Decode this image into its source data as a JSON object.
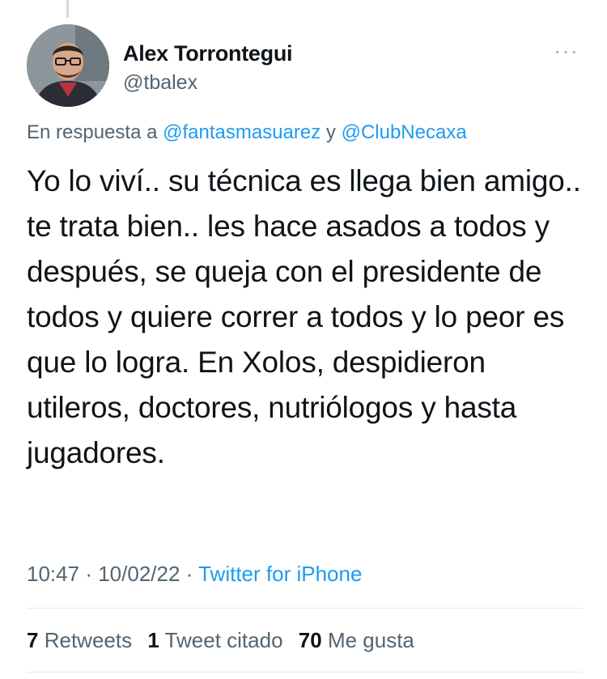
{
  "author": {
    "name": "Alex Torrontegui",
    "handle": "@tbalex"
  },
  "more_menu": {
    "icon": "more-horizontal-icon",
    "label": "···"
  },
  "reply": {
    "prefix": "En respuesta a",
    "mention1": "@fantasmasuarez",
    "conjunction": "y",
    "mention2": "@ClubNecaxa"
  },
  "tweet": {
    "text": "Yo lo viví.. su técnica es llega bien amigo.. te trata bien.. les hace asados a todos y después, se queja con el presidente de todos y quiere correr a todos y lo peor es que lo logra. En Xolos, despidieron utileros, doctores, nutriólogos y hasta jugadores."
  },
  "meta": {
    "time": "10:47",
    "sep1": "·",
    "date": "10/02/22",
    "sep2": "·",
    "source": "Twitter for iPhone"
  },
  "stats": {
    "retweets_count": "7",
    "retweets_label": "Retweets",
    "quotes_count": "1",
    "quotes_label": "Tweet citado",
    "likes_count": "70",
    "likes_label": "Me gusta"
  },
  "colors": {
    "link": "#1d9bf0",
    "text": "#0f1419",
    "secondary": "#536471",
    "divider": "#e1e8ed"
  }
}
